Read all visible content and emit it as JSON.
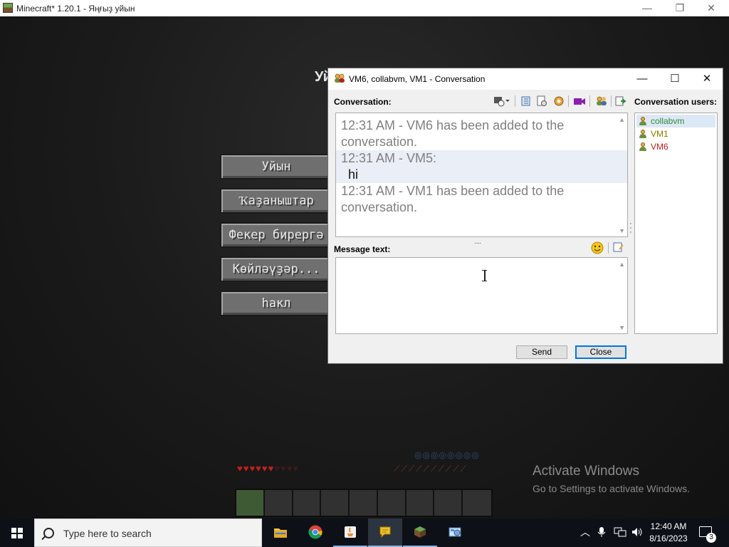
{
  "minecraft": {
    "title": "Minecraft* 1.20.1 - Яңғыҙ уйын",
    "title_fragment": "Уй",
    "buttons": [
      "Уйын",
      "Ҡаҙаныштар",
      "Фекер бирергә",
      "Көйләүҙәр...",
      "hакл"
    ]
  },
  "conversation": {
    "title": "VM6, collabvm, VM1 - Conversation",
    "conversation_label": "Conversation:",
    "message_label": "Message text:",
    "users_label": "Conversation users:",
    "log": [
      {
        "kind": "system",
        "text": "12:31 AM - VM6 has been added to the conversation."
      },
      {
        "kind": "header",
        "text": "12:31 AM - VM5:"
      },
      {
        "kind": "message",
        "text": "hi"
      },
      {
        "kind": "system",
        "text": "12:31 AM - VM1 has been added to the conversation."
      }
    ],
    "message_value": "",
    "users": [
      {
        "name": "collabvm",
        "color": "#2e8b3a",
        "selected": true
      },
      {
        "name": "VM1",
        "color": "#8a7a00",
        "selected": false
      },
      {
        "name": "VM6",
        "color": "#b0271c",
        "selected": false
      }
    ],
    "send_label": "Send",
    "close_label": "Close"
  },
  "activation": {
    "line1": "Activate Windows",
    "line2": "Go to Settings to activate Windows."
  },
  "taskbar": {
    "search_placeholder": "Type here to search",
    "time": "12:40 AM",
    "date": "8/16/2023",
    "notification_count": "3"
  }
}
